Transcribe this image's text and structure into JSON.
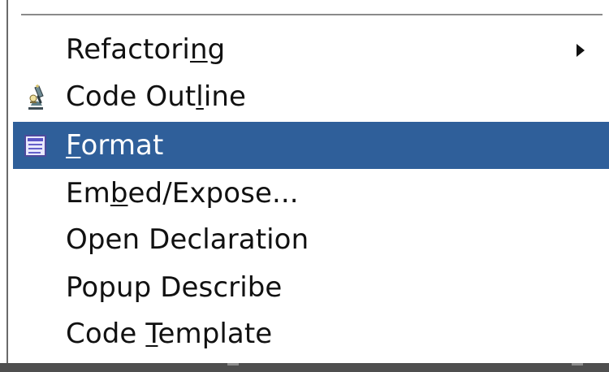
{
  "menu": {
    "items": [
      {
        "prefix": "Refactori",
        "mnemonic": "n",
        "suffix": "g",
        "has_submenu": true
      },
      {
        "prefix": "Code Out",
        "mnemonic": "l",
        "suffix": "ine",
        "icon": "microscope-icon"
      },
      {
        "prefix": "",
        "mnemonic": "F",
        "suffix": "ormat",
        "icon": "document-lines-icon",
        "selected": true
      },
      {
        "prefix": "Em",
        "mnemonic": "b",
        "suffix": "ed/Expose..."
      },
      {
        "prefix": "Open Declaration",
        "mnemonic": "",
        "suffix": ""
      },
      {
        "prefix": "Popup Describe",
        "mnemonic": "",
        "suffix": ""
      },
      {
        "prefix": "Code ",
        "mnemonic": "T",
        "suffix": "emplate"
      }
    ]
  },
  "colors": {
    "selection": "#2f5f9a",
    "text": "#111111",
    "selected_text": "#ffffff"
  }
}
